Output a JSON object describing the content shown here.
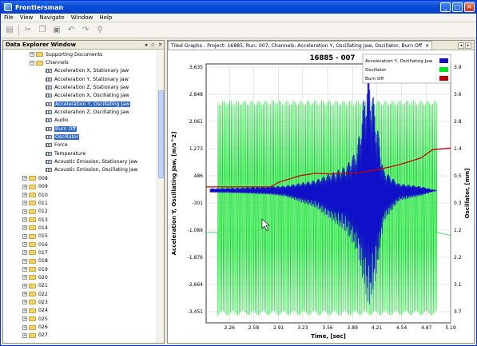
{
  "window": {
    "title": "Frontiersman",
    "minimize": "_",
    "maximize": "□",
    "close": "✕"
  },
  "menu": [
    "File",
    "View",
    "Navigate",
    "Window",
    "Help"
  ],
  "toolbar_icons": [
    "save-icon",
    "cut-icon",
    "copy-icon",
    "paste-icon",
    "undo-icon",
    "redo-icon",
    "search-icon"
  ],
  "left": {
    "title": "Data Explorer Window",
    "minimize_glyph": "◂",
    "restore_glyph": "▫",
    "close_glyph": "✕",
    "tree": [
      {
        "kind": "folder",
        "expander": "+",
        "label": "Supporting Documents",
        "indent": 1
      },
      {
        "kind": "folder",
        "expander": "−",
        "label": "Channels",
        "indent": 1
      },
      {
        "kind": "channel",
        "label": "Acceleration X, Stationary Jaw",
        "indent": 2
      },
      {
        "kind": "channel",
        "label": "Acceleration Y, Stationary Jaw",
        "indent": 2
      },
      {
        "kind": "channel",
        "label": "Acceleration Z, Stationary Jaw",
        "indent": 2
      },
      {
        "kind": "channel",
        "label": "Acceleration X, Oscillating Jaw",
        "indent": 2
      },
      {
        "kind": "channel",
        "label": "Acceleration Y, Oscillating Jaw",
        "indent": 2,
        "selected": true
      },
      {
        "kind": "channel",
        "label": "Acceleration Z, Oscillating Jaw",
        "indent": 2
      },
      {
        "kind": "channel",
        "label": "Audio",
        "indent": 2
      },
      {
        "kind": "channel",
        "label": "Burn Off",
        "indent": 2,
        "selected": true
      },
      {
        "kind": "channel",
        "label": "Oscillator",
        "indent": 2,
        "selected": true
      },
      {
        "kind": "channel",
        "label": "Force",
        "indent": 2
      },
      {
        "kind": "channel",
        "label": "Temperature",
        "indent": 2
      },
      {
        "kind": "channel",
        "label": "Acoustic Emission, Stationary Jaw",
        "indent": 2
      },
      {
        "kind": "channel",
        "label": "Acoustic Emission, Oscillating Jaw",
        "indent": 2
      },
      {
        "kind": "folder",
        "expander": "+",
        "label": "008",
        "indent": 0
      },
      {
        "kind": "folder",
        "expander": "+",
        "label": "009",
        "indent": 0
      },
      {
        "kind": "folder",
        "expander": "+",
        "label": "010",
        "indent": 0
      },
      {
        "kind": "folder",
        "expander": "+",
        "label": "011",
        "indent": 0
      },
      {
        "kind": "folder",
        "expander": "+",
        "label": "012",
        "indent": 0
      },
      {
        "kind": "folder",
        "expander": "+",
        "label": "013",
        "indent": 0
      },
      {
        "kind": "folder",
        "expander": "+",
        "label": "014",
        "indent": 0
      },
      {
        "kind": "folder",
        "expander": "+",
        "label": "015",
        "indent": 0
      },
      {
        "kind": "folder",
        "expander": "+",
        "label": "016",
        "indent": 0
      },
      {
        "kind": "folder",
        "expander": "+",
        "label": "017",
        "indent": 0
      },
      {
        "kind": "folder",
        "expander": "+",
        "label": "018",
        "indent": 0
      },
      {
        "kind": "folder",
        "expander": "+",
        "label": "019",
        "indent": 0
      },
      {
        "kind": "folder",
        "expander": "+",
        "label": "020",
        "indent": 0
      },
      {
        "kind": "folder",
        "expander": "+",
        "label": "021",
        "indent": 0
      },
      {
        "kind": "folder",
        "expander": "+",
        "label": "022",
        "indent": 0
      },
      {
        "kind": "folder",
        "expander": "+",
        "label": "023",
        "indent": 0
      },
      {
        "kind": "folder",
        "expander": "+",
        "label": "024",
        "indent": 0
      },
      {
        "kind": "folder",
        "expander": "+",
        "label": "025",
        "indent": 0
      },
      {
        "kind": "folder",
        "expander": "+",
        "label": "026",
        "indent": 0
      },
      {
        "kind": "folder",
        "expander": "+",
        "label": "027",
        "indent": 0
      }
    ]
  },
  "right": {
    "tab_label": "Tiled Graphs - Project: 16885, Run: 007, Channels: Acceleration Y, Oscillating Jaw, Oscillator, Burn Off",
    "tab_close": "✕",
    "nav_left": "◂",
    "nav_right": "▸"
  },
  "chart_data": {
    "type": "line",
    "title": "16885 - 007",
    "xlabel": "Time, [sec]",
    "ylabel": "Acceleration Y, Oscillating Jaw, [m/s^2]",
    "y2label": "Oscillator, [mm]",
    "x_ticks": [
      "2.26",
      "2.58",
      "2.91",
      "3.23",
      "3.56",
      "3.89",
      "4.21",
      "4.54",
      "4.87",
      "5.19"
    ],
    "xlim": [
      1.95,
      5.19
    ],
    "y_ticks": [
      "3,635",
      "2,848",
      "2,061",
      "1,273",
      "486",
      "-301",
      "-1,089",
      "-1,876",
      "-2,664",
      "-3,451"
    ],
    "ylim": [
      -3800,
      3635
    ],
    "y2_ticks": [
      "3.9",
      "3.6",
      "2.8",
      "1.4",
      "0.5",
      "0.3",
      "1.2",
      "2.2",
      "3.1",
      "3.7"
    ],
    "y2lim": [
      -4.0,
      4.0
    ],
    "grid": true,
    "legend_position": "top-right",
    "series": [
      {
        "name": "Acceleration Y, Oscillating Jaw",
        "color": "#1010c8",
        "note_range": "amplitude grows near 4.1-4.3 s",
        "x": [
          2.0,
          2.4,
          2.8,
          3.0,
          3.4,
          3.8,
          3.95,
          4.1,
          4.2,
          4.3,
          4.5,
          4.8,
          5.0
        ],
        "y_max": [
          60,
          80,
          120,
          140,
          300,
          700,
          1200,
          3600,
          2200,
          600,
          200,
          120,
          0
        ],
        "y_min": [
          -60,
          -80,
          -120,
          -180,
          -500,
          -1200,
          -1800,
          -3400,
          -2500,
          -900,
          -300,
          -150,
          0
        ]
      },
      {
        "name": "Oscillator",
        "color": "#00e020",
        "x": [
          1.95,
          2.05,
          2.1,
          5.0,
          5.1,
          5.19
        ],
        "y_max": [
          -1.2,
          -1.2,
          2.8,
          2.8,
          -1.2,
          -1.3
        ],
        "y_min": [
          -1.2,
          -1.2,
          -3.7,
          -3.7,
          -1.2,
          -1.3
        ]
      },
      {
        "name": "Burn Off",
        "color": "#c00000",
        "x": [
          1.95,
          2.8,
          2.92,
          3.2,
          3.4,
          3.6,
          3.9,
          4.2,
          4.5,
          4.8,
          4.95,
          5.19
        ],
        "y": [
          0.2,
          0.2,
          0.35,
          0.55,
          0.62,
          0.6,
          0.62,
          0.72,
          0.88,
          1.1,
          1.35,
          1.4
        ]
      }
    ]
  }
}
